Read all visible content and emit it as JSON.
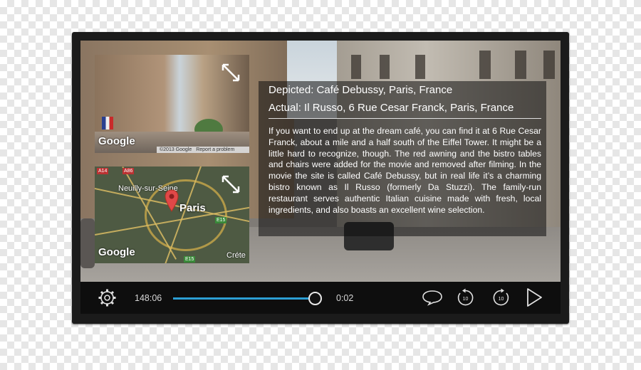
{
  "info": {
    "depicted": "Depicted: Café Debussy, Paris, France",
    "actual": "Actual: Il Russo, 6 Rue Cesar Franck, Paris, France",
    "description": "If you want to end up at the dream café, you can find it at 6 Rue Cesar Franck, about a mile and a half south of the Eiffel Tower.  It might be a little hard to recognize, though.  The red awning and the bistro tables and chairs were added for the movie and removed after filming.  In the movie the site is called Café Debussy, but in real life it’s a charming bistro known as Il Russo (formerly Da Stuzzi).    The family-run restaurant serves authentic Italian cuisine made with fresh, local ingredients, and also boasts an excellent wine selection."
  },
  "street_view": {
    "brand": "Google",
    "footer_brand": "©2013 Google",
    "footer_link": "Report a problem"
  },
  "map": {
    "brand": "Google",
    "city": "Paris",
    "label_neuilly": "Neuilly-sur-Seine",
    "label_creteil": "Créte",
    "roads": [
      "A14",
      "A86",
      "E15",
      "E15"
    ]
  },
  "player": {
    "elapsed": "148:06",
    "remaining": "0:02",
    "progress": 0.97,
    "icons": [
      "settings-icon",
      "subtitles-icon",
      "rewind-10-icon",
      "forward-10-icon",
      "play-icon"
    ],
    "accent": "#2c9fd4"
  }
}
